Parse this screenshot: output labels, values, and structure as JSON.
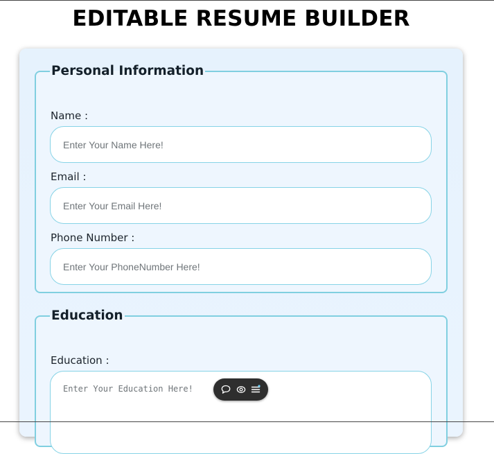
{
  "page": {
    "title": "EDITABLE RESUME BUILDER"
  },
  "personal": {
    "legend": "Personal Information",
    "name_label": "Name :",
    "name_placeholder": "Enter Your Name Here!",
    "email_label": "Email :",
    "email_placeholder": "Enter Your Email Here!",
    "phone_label": "Phone Number :",
    "phone_placeholder": "Enter Your PhoneNumber Here!"
  },
  "education": {
    "legend": "Education",
    "label": "Education :",
    "placeholder": "Enter Your Education Here!"
  },
  "toolbar": {
    "icons": [
      "chat-bubble-icon",
      "eye-icon",
      "menu-lines-icon"
    ]
  },
  "colors": {
    "border_accent": "#80cfe0",
    "card_background": "#e6f2fd",
    "toolbar_background": "#2e2e2e"
  }
}
